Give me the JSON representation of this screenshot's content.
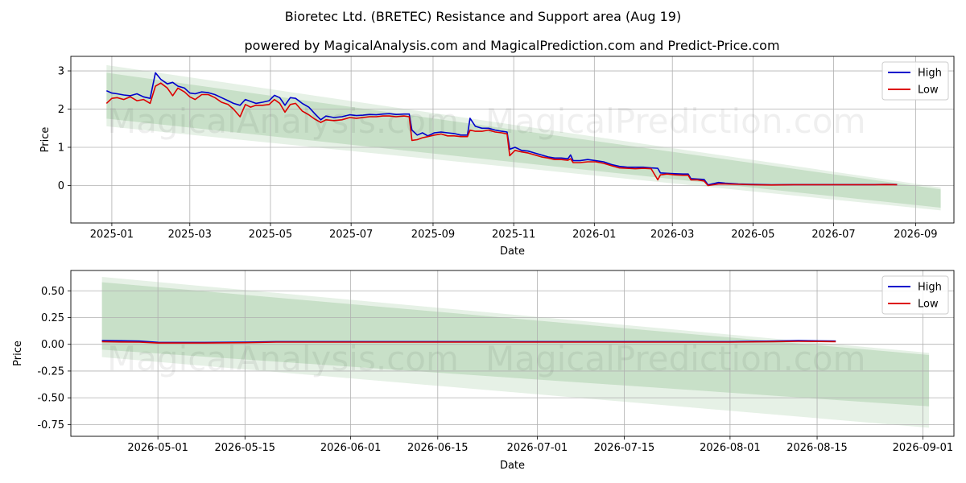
{
  "title": "Bioretec Ltd. (BRETEC) Resistance and Support area (Aug 19)",
  "subtitle": "powered by MagicalAnalysis.com and MagicalPrediction.com and Predict-Price.com",
  "watermarks": [
    "MagicalAnalysis.com",
    "MagicalPrediction.com"
  ],
  "colors": {
    "high": "#0000cc",
    "low": "#dd0000",
    "band": "#2e8b2e",
    "grid": "#b0b0b0"
  },
  "chart_data": [
    {
      "type": "line",
      "xlabel": "Date",
      "ylabel": "Price",
      "legend_position": "top-right",
      "grid": true,
      "xlim": [
        "2024-12-01",
        "2026-09-30"
      ],
      "ylim": [
        -0.98,
        3.38
      ],
      "xticks": [
        "2025-01",
        "2025-03",
        "2025-05",
        "2025-07",
        "2025-09",
        "2025-11",
        "2026-01",
        "2026-03",
        "2026-05",
        "2026-07",
        "2026-09"
      ],
      "yticks": [
        0,
        1,
        2,
        3
      ],
      "bands": [
        {
          "start": "2024-12-28",
          "end": "2026-09-20",
          "upper": [
            3.15,
            -0.05
          ],
          "lower": [
            1.55,
            -0.65
          ],
          "opacity": 0.12
        },
        {
          "start": "2024-12-28",
          "end": "2026-09-20",
          "upper": [
            2.95,
            -0.1
          ],
          "lower": [
            1.75,
            -0.58
          ],
          "opacity": 0.16
        }
      ],
      "series": [
        {
          "name": "High",
          "x": [
            "2024-12-28",
            "2025-01-01",
            "2025-01-05",
            "2025-01-10",
            "2025-01-15",
            "2025-01-20",
            "2025-01-25",
            "2025-01-30",
            "2025-02-03",
            "2025-02-07",
            "2025-02-12",
            "2025-02-16",
            "2025-02-20",
            "2025-02-25",
            "2025-03-01",
            "2025-03-05",
            "2025-03-10",
            "2025-03-15",
            "2025-03-20",
            "2025-03-25",
            "2025-03-30",
            "2025-04-03",
            "2025-04-08",
            "2025-04-12",
            "2025-04-16",
            "2025-04-20",
            "2025-04-25",
            "2025-04-30",
            "2025-05-04",
            "2025-05-08",
            "2025-05-12",
            "2025-05-16",
            "2025-05-20",
            "2025-05-25",
            "2025-05-30",
            "2025-06-03",
            "2025-06-08",
            "2025-06-12",
            "2025-06-18",
            "2025-06-24",
            "2025-06-30",
            "2025-07-05",
            "2025-07-10",
            "2025-07-15",
            "2025-07-20",
            "2025-07-25",
            "2025-07-30",
            "2025-08-04",
            "2025-08-10",
            "2025-08-14",
            "2025-08-16",
            "2025-08-20",
            "2025-08-24",
            "2025-08-28",
            "2025-09-02",
            "2025-09-07",
            "2025-09-12",
            "2025-09-17",
            "2025-09-22",
            "2025-09-27",
            "2025-09-29",
            "2025-10-03",
            "2025-10-08",
            "2025-10-13",
            "2025-10-18",
            "2025-10-23",
            "2025-10-27",
            "2025-10-29",
            "2025-11-02",
            "2025-11-07",
            "2025-11-12",
            "2025-11-17",
            "2025-11-22",
            "2025-11-27",
            "2025-12-02",
            "2025-12-07",
            "2025-12-12",
            "2025-12-14",
            "2025-12-16",
            "2025-12-21",
            "2025-12-27",
            "2026-01-02",
            "2026-01-08",
            "2026-01-14",
            "2026-01-20",
            "2026-01-26",
            "2026-02-01",
            "2026-02-07",
            "2026-02-13",
            "2026-02-18",
            "2026-02-20",
            "2026-02-25",
            "2026-03-03",
            "2026-03-09",
            "2026-03-13",
            "2026-03-15",
            "2026-03-20",
            "2026-03-25",
            "2026-03-28",
            "2026-04-01",
            "2026-04-05",
            "2026-04-10",
            "2026-04-20",
            "2026-05-01",
            "2026-05-15",
            "2026-06-01",
            "2026-06-20",
            "2026-07-05",
            "2026-07-20",
            "2026-08-01",
            "2026-08-10",
            "2026-08-18"
          ],
          "values": [
            2.48,
            2.42,
            2.4,
            2.37,
            2.35,
            2.4,
            2.32,
            2.28,
            2.95,
            2.78,
            2.66,
            2.7,
            2.6,
            2.55,
            2.42,
            2.4,
            2.45,
            2.43,
            2.38,
            2.3,
            2.22,
            2.15,
            2.1,
            2.25,
            2.2,
            2.15,
            2.18,
            2.22,
            2.36,
            2.3,
            2.1,
            2.3,
            2.28,
            2.15,
            2.05,
            1.9,
            1.72,
            1.82,
            1.78,
            1.8,
            1.85,
            1.83,
            1.84,
            1.86,
            1.85,
            1.87,
            1.88,
            1.86,
            1.87,
            1.87,
            1.45,
            1.32,
            1.38,
            1.3,
            1.38,
            1.4,
            1.38,
            1.36,
            1.32,
            1.32,
            1.76,
            1.55,
            1.5,
            1.5,
            1.45,
            1.42,
            1.4,
            0.95,
            1.0,
            0.92,
            0.9,
            0.85,
            0.8,
            0.75,
            0.72,
            0.72,
            0.7,
            0.8,
            0.65,
            0.65,
            0.68,
            0.65,
            0.62,
            0.55,
            0.5,
            0.48,
            0.48,
            0.48,
            0.46,
            0.45,
            0.33,
            0.32,
            0.31,
            0.3,
            0.3,
            0.18,
            0.17,
            0.16,
            0.02,
            0.05,
            0.08,
            0.06,
            0.04,
            0.03,
            0.02,
            0.025,
            0.025,
            0.025,
            0.025,
            0.025,
            0.03,
            0.025
          ]
        },
        {
          "name": "Low",
          "x": [
            "2024-12-28",
            "2025-01-01",
            "2025-01-05",
            "2025-01-10",
            "2025-01-15",
            "2025-01-20",
            "2025-01-25",
            "2025-01-30",
            "2025-02-03",
            "2025-02-07",
            "2025-02-12",
            "2025-02-16",
            "2025-02-20",
            "2025-02-25",
            "2025-03-01",
            "2025-03-05",
            "2025-03-10",
            "2025-03-15",
            "2025-03-20",
            "2025-03-25",
            "2025-03-30",
            "2025-04-03",
            "2025-04-08",
            "2025-04-12",
            "2025-04-16",
            "2025-04-20",
            "2025-04-25",
            "2025-04-30",
            "2025-05-04",
            "2025-05-08",
            "2025-05-12",
            "2025-05-16",
            "2025-05-20",
            "2025-05-25",
            "2025-05-30",
            "2025-06-03",
            "2025-06-08",
            "2025-06-12",
            "2025-06-18",
            "2025-06-24",
            "2025-06-30",
            "2025-07-05",
            "2025-07-10",
            "2025-07-15",
            "2025-07-20",
            "2025-07-25",
            "2025-07-30",
            "2025-08-04",
            "2025-08-10",
            "2025-08-14",
            "2025-08-16",
            "2025-08-20",
            "2025-08-24",
            "2025-08-28",
            "2025-09-02",
            "2025-09-07",
            "2025-09-12",
            "2025-09-17",
            "2025-09-22",
            "2025-09-27",
            "2025-09-29",
            "2025-10-03",
            "2025-10-08",
            "2025-10-13",
            "2025-10-18",
            "2025-10-23",
            "2025-10-27",
            "2025-10-29",
            "2025-11-02",
            "2025-11-07",
            "2025-11-12",
            "2025-11-17",
            "2025-11-22",
            "2025-11-27",
            "2025-12-02",
            "2025-12-07",
            "2025-12-12",
            "2025-12-14",
            "2025-12-16",
            "2025-12-21",
            "2025-12-27",
            "2026-01-02",
            "2026-01-08",
            "2026-01-14",
            "2026-01-20",
            "2026-01-26",
            "2026-02-01",
            "2026-02-07",
            "2026-02-13",
            "2026-02-18",
            "2026-02-20",
            "2026-02-25",
            "2026-03-03",
            "2026-03-09",
            "2026-03-13",
            "2026-03-15",
            "2026-03-20",
            "2026-03-25",
            "2026-03-28",
            "2026-04-01",
            "2026-04-05",
            "2026-04-10",
            "2026-04-20",
            "2026-05-01",
            "2026-05-15",
            "2026-06-01",
            "2026-06-20",
            "2026-07-05",
            "2026-07-20",
            "2026-08-01",
            "2026-08-10",
            "2026-08-18"
          ],
          "values": [
            2.15,
            2.28,
            2.3,
            2.25,
            2.32,
            2.22,
            2.25,
            2.15,
            2.6,
            2.68,
            2.55,
            2.35,
            2.55,
            2.45,
            2.32,
            2.25,
            2.38,
            2.38,
            2.3,
            2.18,
            2.12,
            2.0,
            1.8,
            2.12,
            2.05,
            2.1,
            2.1,
            2.12,
            2.25,
            2.15,
            1.92,
            2.12,
            2.15,
            1.95,
            1.85,
            1.75,
            1.65,
            1.72,
            1.7,
            1.72,
            1.78,
            1.76,
            1.78,
            1.8,
            1.8,
            1.82,
            1.82,
            1.8,
            1.82,
            1.8,
            1.18,
            1.2,
            1.25,
            1.28,
            1.32,
            1.35,
            1.3,
            1.3,
            1.28,
            1.28,
            1.45,
            1.42,
            1.42,
            1.45,
            1.4,
            1.38,
            1.35,
            0.78,
            0.92,
            0.88,
            0.85,
            0.8,
            0.75,
            0.72,
            0.68,
            0.68,
            0.66,
            0.7,
            0.6,
            0.6,
            0.62,
            0.62,
            0.58,
            0.52,
            0.46,
            0.45,
            0.44,
            0.45,
            0.44,
            0.15,
            0.28,
            0.3,
            0.28,
            0.27,
            0.27,
            0.15,
            0.15,
            0.12,
            0.0,
            0.02,
            0.04,
            0.04,
            0.03,
            0.02,
            0.015,
            0.02,
            0.02,
            0.02,
            0.02,
            0.02,
            0.025,
            0.02
          ]
        }
      ]
    },
    {
      "type": "line",
      "xlabel": "Date",
      "ylabel": "Price",
      "legend_position": "top-right",
      "grid": true,
      "xlim": [
        "2026-04-17",
        "2026-09-06"
      ],
      "ylim": [
        -0.86,
        0.69
      ],
      "xticks": [
        "2026-05-01",
        "2026-05-15",
        "2026-06-01",
        "2026-06-15",
        "2026-07-01",
        "2026-07-15",
        "2026-08-01",
        "2026-08-15",
        "2026-09-01"
      ],
      "yticks": [
        -0.75,
        -0.5,
        -0.25,
        0.0,
        0.25,
        0.5
      ],
      "bands": [
        {
          "start": "2026-04-22",
          "end": "2026-09-02",
          "upper": [
            0.63,
            -0.08
          ],
          "lower": [
            -0.12,
            -0.78
          ],
          "opacity": 0.12
        },
        {
          "start": "2026-04-22",
          "end": "2026-09-02",
          "upper": [
            0.58,
            -0.1
          ],
          "lower": [
            -0.05,
            -0.58
          ],
          "opacity": 0.16
        }
      ],
      "series": [
        {
          "name": "High",
          "x": [
            "2026-04-22",
            "2026-04-25",
            "2026-04-28",
            "2026-05-01",
            "2026-05-08",
            "2026-05-15",
            "2026-05-20",
            "2026-06-01",
            "2026-06-15",
            "2026-07-01",
            "2026-07-15",
            "2026-08-01",
            "2026-08-08",
            "2026-08-12",
            "2026-08-18"
          ],
          "values": [
            0.035,
            0.033,
            0.03,
            0.018,
            0.017,
            0.02,
            0.025,
            0.025,
            0.025,
            0.025,
            0.025,
            0.025,
            0.03,
            0.035,
            0.03
          ]
        },
        {
          "name": "Low",
          "x": [
            "2026-04-22",
            "2026-04-25",
            "2026-04-28",
            "2026-05-01",
            "2026-05-08",
            "2026-05-15",
            "2026-05-20",
            "2026-06-01",
            "2026-06-15",
            "2026-07-01",
            "2026-07-15",
            "2026-08-01",
            "2026-08-08",
            "2026-08-12",
            "2026-08-18"
          ],
          "values": [
            0.025,
            0.022,
            0.02,
            0.012,
            0.012,
            0.015,
            0.02,
            0.02,
            0.02,
            0.02,
            0.02,
            0.02,
            0.025,
            0.028,
            0.025
          ]
        }
      ]
    }
  ]
}
